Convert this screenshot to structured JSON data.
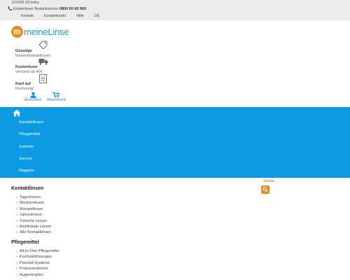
{
  "topbar": {
    "covid": "COVID-19 Infos",
    "hotline_label": "Kostenloser Bestellservice",
    "hotline_number": "0800 60 60 960",
    "links": [
      "Kontakt",
      "Kundenkonto",
      "Hilfe",
      "DE"
    ]
  },
  "logo": {
    "mark": "m",
    "text": "meineLinse"
  },
  "usps": [
    {
      "title": "Günstige",
      "sub": "Markenkontaktlinsen",
      "icon": "tag-icon"
    },
    {
      "title": "Kostenloser",
      "sub": "Versand ab 40€",
      "icon": "truck-icon"
    },
    {
      "title": "Kauf auf",
      "sub": "Rechnung¹",
      "icon": "invoice-icon"
    }
  ],
  "account": {
    "login": "Anmelden",
    "cart": "Warenkorb"
  },
  "nav": {
    "items": [
      "Kontaktlinsen",
      "Pflegemittel",
      "Zubehör",
      "Service",
      "Magazin"
    ]
  },
  "search": {
    "placeholder": "Suche..."
  },
  "sections": [
    {
      "title": "Kontaktlinsen",
      "items": [
        "Tageslinsen",
        "Wochenlinsen",
        "Monatslinsen",
        "Jahreslinsen",
        "Torische Linsen",
        "Multifokale Linsen",
        "Alle Kontaktlinsen"
      ]
    },
    {
      "title": "Pflegemittel",
      "items": [
        "All-in-One Pflegemittel",
        "Kochsalzlösungen",
        "Peroxid-Systeme",
        "Proteinentferner",
        "Augentropfen"
      ]
    }
  ],
  "colors": {
    "nav_blue": "#0d9ae4",
    "accent_orange": "#f08a1c",
    "link_blue": "#1a8ed8"
  }
}
